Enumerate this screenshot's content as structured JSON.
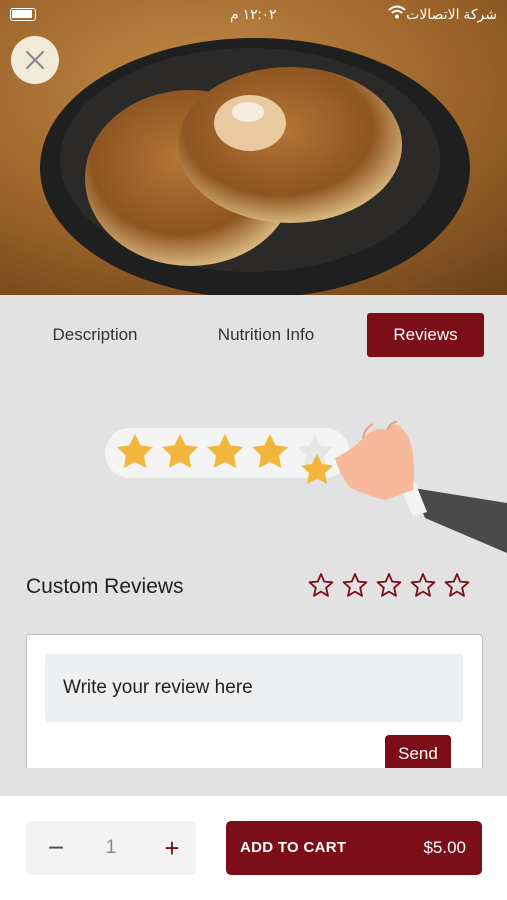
{
  "status_bar": {
    "time": "١٢:٠٢ م",
    "carrier": "شركة الاتصالات"
  },
  "tabs": [
    {
      "label": "Description",
      "active": false
    },
    {
      "label": "Nutrition Info",
      "active": false
    },
    {
      "label": "Reviews",
      "active": true
    }
  ],
  "reviews": {
    "section_title": "Custom Reviews",
    "rating_stars_total": 5,
    "rating_selected": 0,
    "input_placeholder": "Write your review here",
    "send_label": "Send"
  },
  "cart": {
    "quantity": "1",
    "add_label": "ADD TO CART",
    "price": "$5.00"
  },
  "colors": {
    "accent": "#7c0e18",
    "background": "#e2e2e2",
    "star_fill": "#f3b63c"
  }
}
